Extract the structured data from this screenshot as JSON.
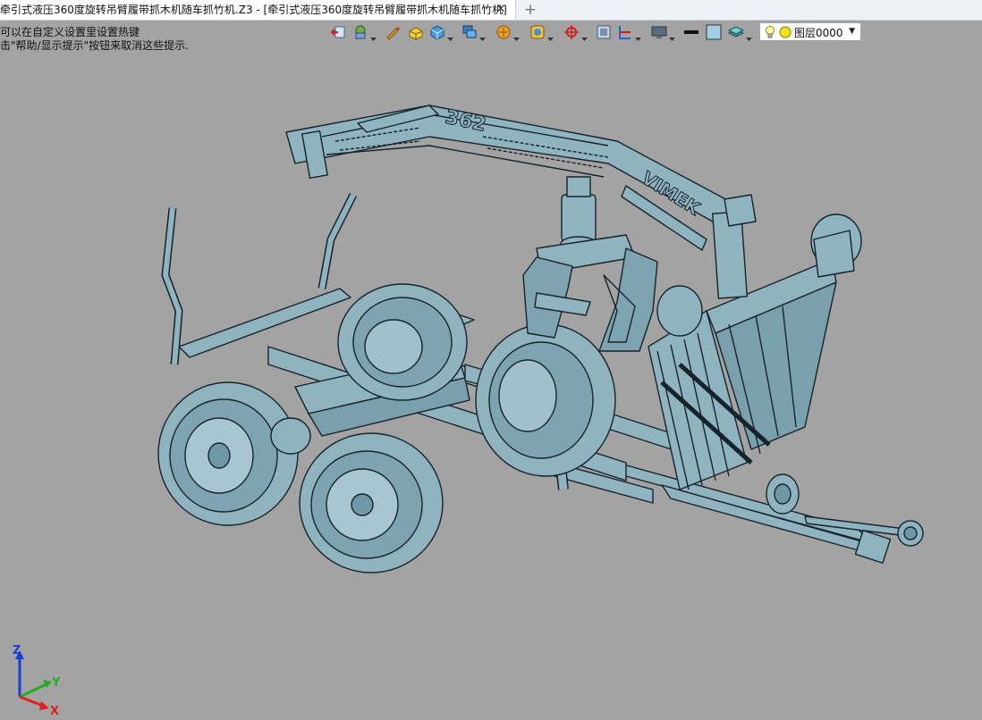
{
  "tab": {
    "title": "牵引式液压360度旋转吊臂履带抓木机随车抓竹机.Z3 - [牵引式液压360度旋转吊臂履带抓木机随车抓竹机]",
    "close_glyph": "✕",
    "add_glyph": "+"
  },
  "hint": {
    "line1": "可以在自定义设置里设置热键",
    "line2": "击\"帮助/显示提示\"按钮来取消这些提示."
  },
  "toolbar": {
    "icons": [
      "exit-icon",
      "shape-dropdown-icon",
      "pen-icon",
      "solid-icon",
      "cube-view-icon",
      "display-mode-icon",
      "render-icon",
      "orbit-icon",
      "axis-icon",
      "fit-icon",
      "section-icon",
      "monitor-icon",
      "line-style-icon",
      "color-icon",
      "layers-icon"
    ]
  },
  "layer": {
    "value": "图层0000"
  },
  "model": {
    "boom_label": "362",
    "brand_label": "VIMEK"
  },
  "triad": {
    "z": "Z",
    "y": "Y",
    "x": "X",
    "colors": {
      "z": "#1a3fd6",
      "y": "#22b022",
      "x": "#e02020"
    }
  },
  "colors": {
    "background": "#a3a3a3",
    "model_fill": "#8fb4c0",
    "model_edge": "#16232a"
  }
}
